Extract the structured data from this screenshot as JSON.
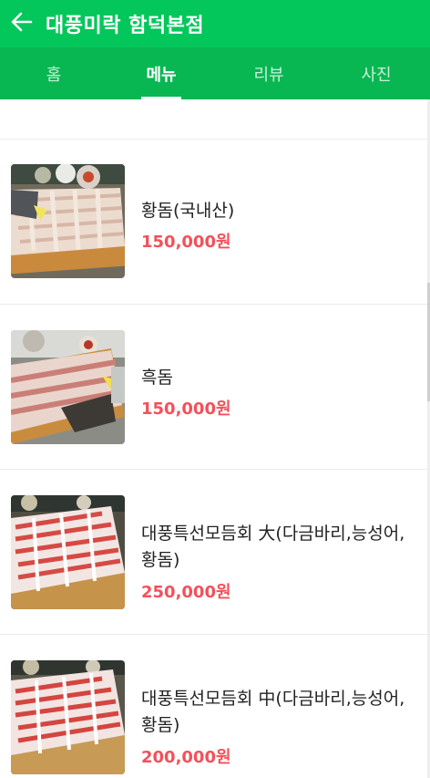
{
  "header": {
    "title": "대풍미락 함덕본점",
    "back_icon": "arrow-left-icon"
  },
  "tabs": [
    {
      "label": "홈",
      "active": false
    },
    {
      "label": "메뉴",
      "active": true
    },
    {
      "label": "리뷰",
      "active": false
    },
    {
      "label": "사진",
      "active": false
    }
  ],
  "menu": {
    "items": [
      {
        "name": "황돔(국내산)",
        "price": "150,000원"
      },
      {
        "name": "흑돔",
        "price": "150,000원"
      },
      {
        "name": "대풍특선모듬회 大(다금바리,능성어,황돔)",
        "price": "250,000원"
      },
      {
        "name": "대풍특선모듬회 中(다금바리,능성어,황돔)",
        "price": "200,000원"
      }
    ]
  },
  "colors": {
    "brand": "#03c75a",
    "tabbar": "#08b752",
    "price": "#f4505a"
  }
}
